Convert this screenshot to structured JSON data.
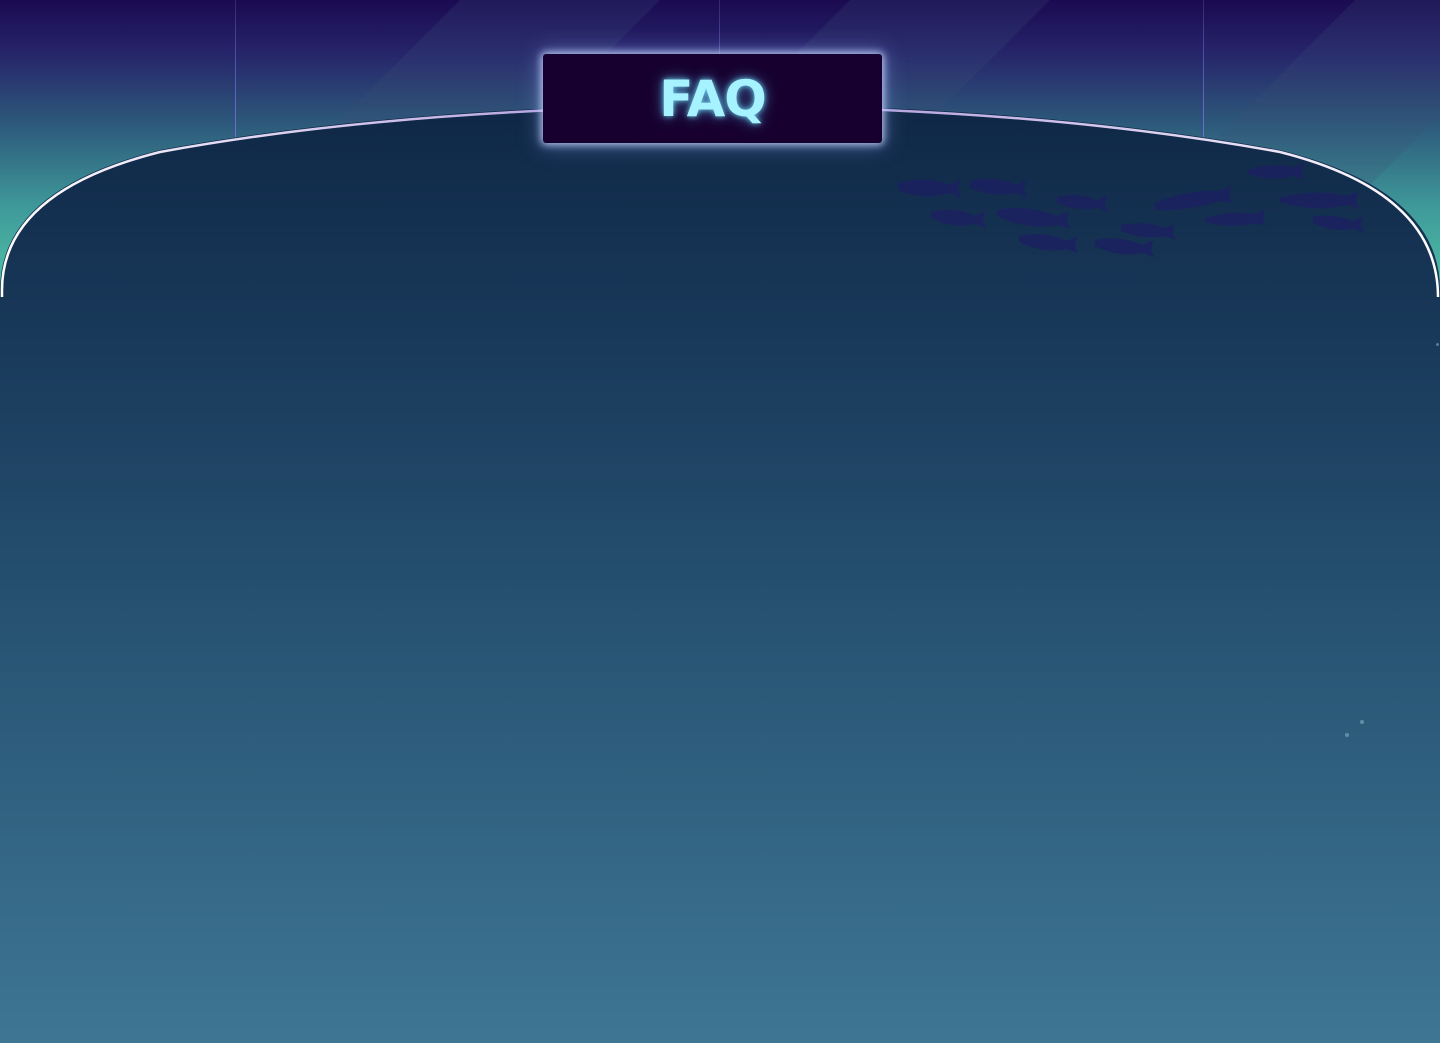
{
  "page": {
    "title": "FAQ"
  },
  "theme": {
    "sky_top": "#1b0a52",
    "sky_bottom": "#4fc3a5",
    "panel_top": "#0f2746",
    "panel_bottom": "#3e7693",
    "badge_bg": "#17002f",
    "title_color": "#a6f3ff",
    "fish_color": "#1a1f5a"
  },
  "decorations": {
    "fish_school": "fish-icon",
    "bubbles": "bubble-icon"
  }
}
